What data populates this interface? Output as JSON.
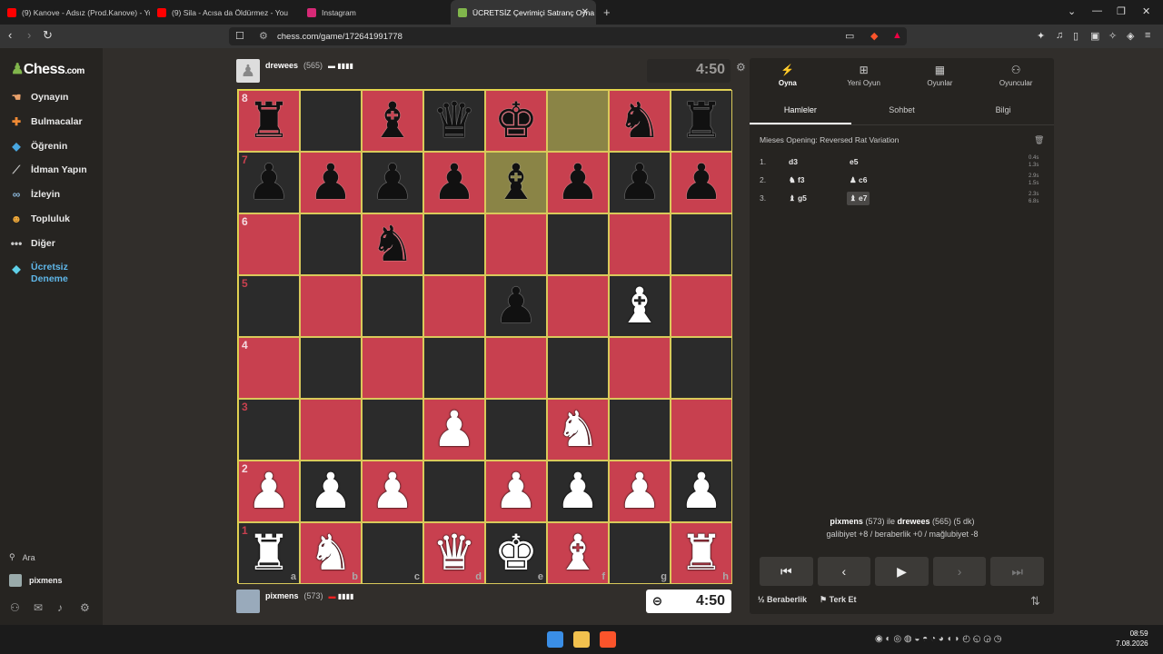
{
  "browser": {
    "tabs": [
      {
        "title": "(9) Kanove - Adsız (Prod.Kanove) - Yo",
        "color": "#ff0000"
      },
      {
        "title": "(9) Sila - Acısa da Öldürmez - You",
        "color": "#ff0000"
      },
      {
        "title": "Instagram",
        "color": "#d62976"
      },
      {
        "title": "ÜCRETSİZ Çevrimiçi Satranç Oyna",
        "color": "#81b64c"
      }
    ],
    "url": "chess.com/game/172641991778"
  },
  "sidebar": {
    "logo": "Chess",
    "logo_suffix": ".com",
    "items": [
      {
        "label": "Oynayın",
        "icon": "play-hand-icon"
      },
      {
        "label": "Bulmacalar",
        "icon": "puzzle-icon"
      },
      {
        "label": "Öğrenin",
        "icon": "graduation-cap-icon"
      },
      {
        "label": "İdman Yapın",
        "icon": "telescope-icon"
      },
      {
        "label": "İzleyin",
        "icon": "binoculars-icon"
      },
      {
        "label": "Topluluk",
        "icon": "community-icon"
      },
      {
        "label": "Diğer",
        "icon": "more-icon"
      }
    ],
    "trial": "Ücretsiz Deneme",
    "search": "Ara",
    "user": "pixmens"
  },
  "top_player": {
    "name": "drewees",
    "rating": "(565)",
    "clock": "4:50"
  },
  "bottom_player": {
    "name": "pixmens",
    "rating": "(573)",
    "clock": "4:50"
  },
  "board": {
    "colors": {
      "light": "#c8404f",
      "dark": "#2b2b2b",
      "highlight": "#8a8446"
    },
    "ranks": [
      "8",
      "7",
      "6",
      "5",
      "4",
      "3",
      "2",
      "1"
    ],
    "files": [
      "a",
      "b",
      "c",
      "d",
      "e",
      "f",
      "g",
      "h"
    ],
    "rows": [
      [
        "br",
        "",
        "bb",
        "bq",
        "bk",
        "hl",
        "bn",
        "br"
      ],
      [
        "bp",
        "bp",
        "bp",
        "bp",
        "bb*",
        "bp",
        "bp",
        "bp"
      ],
      [
        "",
        "",
        "bn",
        "",
        "",
        "",
        "",
        ""
      ],
      [
        "",
        "",
        "",
        "",
        "bp",
        "",
        "wb",
        ""
      ],
      [
        "",
        "",
        "",
        "",
        "",
        "",
        "",
        ""
      ],
      [
        "",
        "",
        "",
        "wp",
        "",
        "wn",
        "",
        ""
      ],
      [
        "wp",
        "wp",
        "wp",
        "",
        "wp",
        "wp",
        "wp",
        "wp"
      ],
      [
        "wr",
        "wn",
        "",
        "wq",
        "wk",
        "wb",
        "",
        "wr"
      ]
    ]
  },
  "panel": {
    "tabs": [
      {
        "label": "Oyna",
        "icon": "bolt-icon"
      },
      {
        "label": "Yeni Oyun",
        "icon": "plus-square-icon"
      },
      {
        "label": "Oyunlar",
        "icon": "board-icon"
      },
      {
        "label": "Oyuncular",
        "icon": "players-icon"
      }
    ],
    "subtabs": [
      "Hamleler",
      "Sohbet",
      "Bilgi"
    ],
    "opening": "Mieses Opening: Reversed Rat Variation",
    "moves": [
      {
        "num": "1.",
        "white": "d3",
        "black": "e5",
        "wt": "0.4s",
        "bt": "1.3s"
      },
      {
        "num": "2.",
        "white": "♞ f3",
        "black": "♟ c6",
        "wt": "2.9s",
        "bt": "1.5s"
      },
      {
        "num": "3.",
        "white": "♝ g5",
        "black": "♝ e7",
        "wt": "2.3s",
        "bt": "6.8s"
      }
    ],
    "summary_p1": "pixmens",
    "summary_p1r": "(573) ile",
    "summary_p2": "drewees",
    "summary_p2r": "(565) (5 dk)",
    "summary_line2": "galibiyet +8 / beraberlik +0 / mağlubiyet -8",
    "draw": "½ Beraberlik",
    "resign": "Terk Et"
  },
  "taskbar": {
    "time": "08:59",
    "date": "7.08.2026"
  }
}
